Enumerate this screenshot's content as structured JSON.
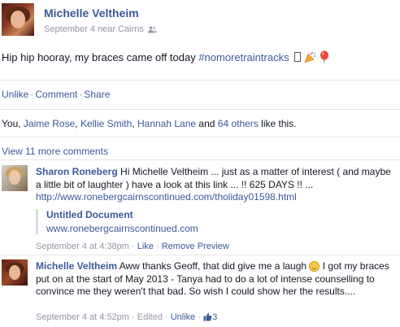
{
  "post": {
    "author": "Michelle Veltheim",
    "date": "September 4 near Cairns",
    "text": "Hip hip hooray, my braces came off today ",
    "hashtag": "#nomoretraintracks"
  },
  "actions": {
    "unlike": "Unlike",
    "comment": "Comment",
    "share": "Share",
    "sep": "·"
  },
  "likes": {
    "prefix": "You, ",
    "p1": "Jaime Rose",
    "p2": "Kellie Smith",
    "p3": "Hannah Lane",
    "and": " and ",
    "others": "64 others",
    "suffix": " like this.",
    "comma": ", "
  },
  "view_more": "View 11 more comments",
  "comments": [
    {
      "author": "Sharon Roneberg",
      "text": " Hi Michelle Veltheim ... just as a matter of interest ( and maybe a little bit of laughter ) have a look at this link ... !! 625 DAYS !! ...",
      "link": "http://www.ronebergcairnscontinued.com/tholiday01598.html",
      "preview_title": "Untitled Document",
      "preview_url": "www.ronebergcairnscontinued.com",
      "time": "September 4 at 4:38pm",
      "like": "Like",
      "remove_preview": "Remove Preview"
    },
    {
      "author": "Michelle Veltheim",
      "text_a": " Aww thanks Geoff, that did give me a laugh ",
      "text_b": " I got my braces put on at the start of May 2013 - Tanya had to do a lot of intense counselling to convince me they weren't that bad. So wish I could show her the results....",
      "time": "September 4 at 4:52pm",
      "edited": "Edited",
      "unlike": "Unlike",
      "like_count": "3"
    }
  ],
  "colors": {
    "link": "#3b5998",
    "muted": "#9197a3",
    "divider": "#e5e5e5"
  }
}
